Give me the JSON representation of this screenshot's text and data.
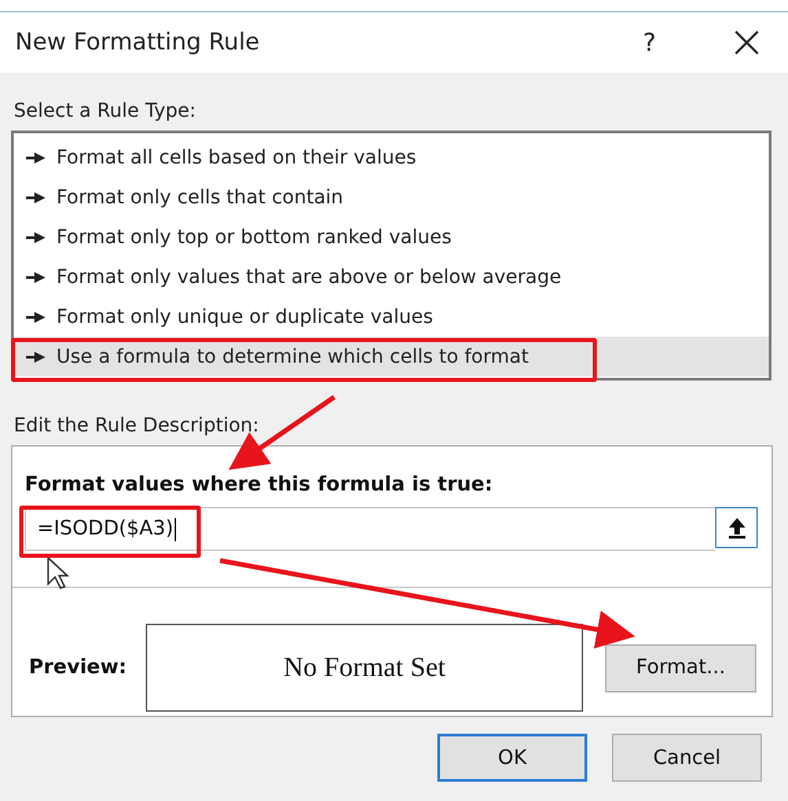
{
  "window": {
    "title": "New Formatting Rule",
    "help": "?"
  },
  "rule_type_label": "Select a Rule Type:",
  "rule_types": [
    {
      "label": "Format all cells based on their values",
      "selected": false
    },
    {
      "label": "Format only cells that contain",
      "selected": false
    },
    {
      "label": "Format only top or bottom ranked values",
      "selected": false
    },
    {
      "label": "Format only values that are above or below average",
      "selected": false
    },
    {
      "label": "Format only unique or duplicate values",
      "selected": false
    },
    {
      "label": "Use a formula to determine which cells to format",
      "selected": true
    }
  ],
  "description_label": "Edit the Rule Description:",
  "formula_label": "Format values where this formula is true:",
  "formula": {
    "value": "=ISODD($A3)"
  },
  "preview": {
    "label": "Preview:",
    "text": "No Format Set",
    "button": "Format..."
  },
  "buttons": [
    {
      "label": "OK",
      "default": true
    },
    {
      "label": "Cancel",
      "default": false
    }
  ]
}
